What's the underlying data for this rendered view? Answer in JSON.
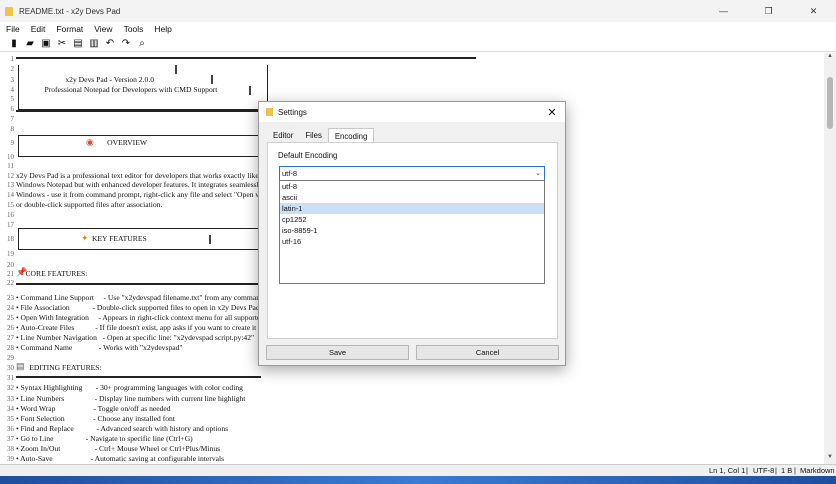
{
  "window": {
    "title": "README.txt - x2y Devs Pad",
    "minimize": "—",
    "maximize": "❐",
    "close": "✕"
  },
  "menu": [
    "File",
    "Edit",
    "Format",
    "View",
    "Tools",
    "Help"
  ],
  "toolbar_icons": [
    "new-file-icon",
    "open-folder-icon",
    "save-icon",
    "cut-icon",
    "copy-icon",
    "paste-icon",
    "undo-icon",
    "redo-icon",
    "find-icon"
  ],
  "editor": {
    "lines": [
      {
        "n": "1",
        "t": ""
      },
      {
        "n": "2",
        "t": ""
      },
      {
        "n": "3",
        "t": "                          x2y Devs Pad - Version 2.0.0"
      },
      {
        "n": "4",
        "t": "               Professional Notepad for Developers with CMD Support"
      },
      {
        "n": "5",
        "t": ""
      },
      {
        "n": "6",
        "t": ""
      },
      {
        "n": "7",
        "t": ""
      },
      {
        "n": "8",
        "t": ""
      },
      {
        "n": "9",
        "t": "                                                OVERVIEW"
      },
      {
        "n": "10",
        "t": ""
      },
      {
        "n": "11",
        "t": ""
      },
      {
        "n": "12",
        "t": "x2y Devs Pad is a professional text editor for developers that works exactly like"
      },
      {
        "n": "13",
        "t": "Windows Notepad but with enhanced developer features. It integrates seamlessl"
      },
      {
        "n": "14",
        "t": "Windows - use it from command prompt, right-click any file and select \"Open w"
      },
      {
        "n": "15",
        "t": "or double-click supported files after association."
      },
      {
        "n": "16",
        "t": ""
      },
      {
        "n": "17",
        "t": ""
      },
      {
        "n": "18",
        "t": "                                        KEY FEATURES"
      },
      {
        "n": "19",
        "t": ""
      },
      {
        "n": "20",
        "t": ""
      },
      {
        "n": "21",
        "t": "     CORE FEATURES:"
      },
      {
        "n": "22",
        "t": ""
      },
      {
        "n": "23",
        "t": "• Command Line Support     - Use \"x2ydevspad filename.txt\" from any comman"
      },
      {
        "n": "24",
        "t": "• File Association            - Double-click supported files to open in x2y Devs Pad"
      },
      {
        "n": "25",
        "t": "• Open With Integration     - Appears in right-click context menu for all supporte"
      },
      {
        "n": "26",
        "t": "• Auto-Create Files           - If file doesn't exist, app asks if you want to create it"
      },
      {
        "n": "27",
        "t": "• Line Number Navigation   - Open at specific line: \"x2ydevspad script.py:42\""
      },
      {
        "n": "28",
        "t": "• Command Name              - Works with \"x2ydevspad\""
      },
      {
        "n": "29",
        "t": ""
      },
      {
        "n": "30",
        "t": "       EDITING FEATURES:"
      },
      {
        "n": "31",
        "t": ""
      },
      {
        "n": "32",
        "t": "• Syntax Highlighting       - 30+ programming languages with color coding"
      },
      {
        "n": "33",
        "t": "• Line Numbers                - Display line numbers with current line highlight"
      },
      {
        "n": "34",
        "t": "• Word Wrap                    - Toggle on/off as needed"
      },
      {
        "n": "35",
        "t": "• Font Selection               - Choose any installed font"
      },
      {
        "n": "36",
        "t": "• Find and Replace            - Advanced search with history and options"
      },
      {
        "n": "37",
        "t": "• Go to Line                 - Navigate to specific line (Ctrl+G)"
      },
      {
        "n": "38",
        "t": "• Zoom In/Out                  - Ctrl+ Mouse Wheel or Ctrl+Plus/Minus"
      },
      {
        "n": "39",
        "t": "• Auto-Save                    - Automatic saving at configurable intervals"
      }
    ]
  },
  "status": {
    "position": "Ln 1, Col 1",
    "encoding": "UTF-8",
    "size": "1 B",
    "language": "Markdown"
  },
  "settings_dialog": {
    "title": "Settings",
    "close": "✕",
    "tabs": [
      "Editor",
      "Files",
      "Encoding"
    ],
    "active_tab": "Encoding",
    "group_label": "Default Encoding",
    "selected": "utf-8",
    "options": [
      "utf-8",
      "ascii",
      "latin-1",
      "cp1252",
      "iso-8859-1",
      "utf-16"
    ],
    "highlighted_option": "latin-1",
    "save_label": "Save",
    "cancel_label": "Cancel"
  },
  "colors": {
    "accent": "#2a72d1",
    "highlight": "#cce0f5",
    "taskbar": "#2a5aa8"
  }
}
